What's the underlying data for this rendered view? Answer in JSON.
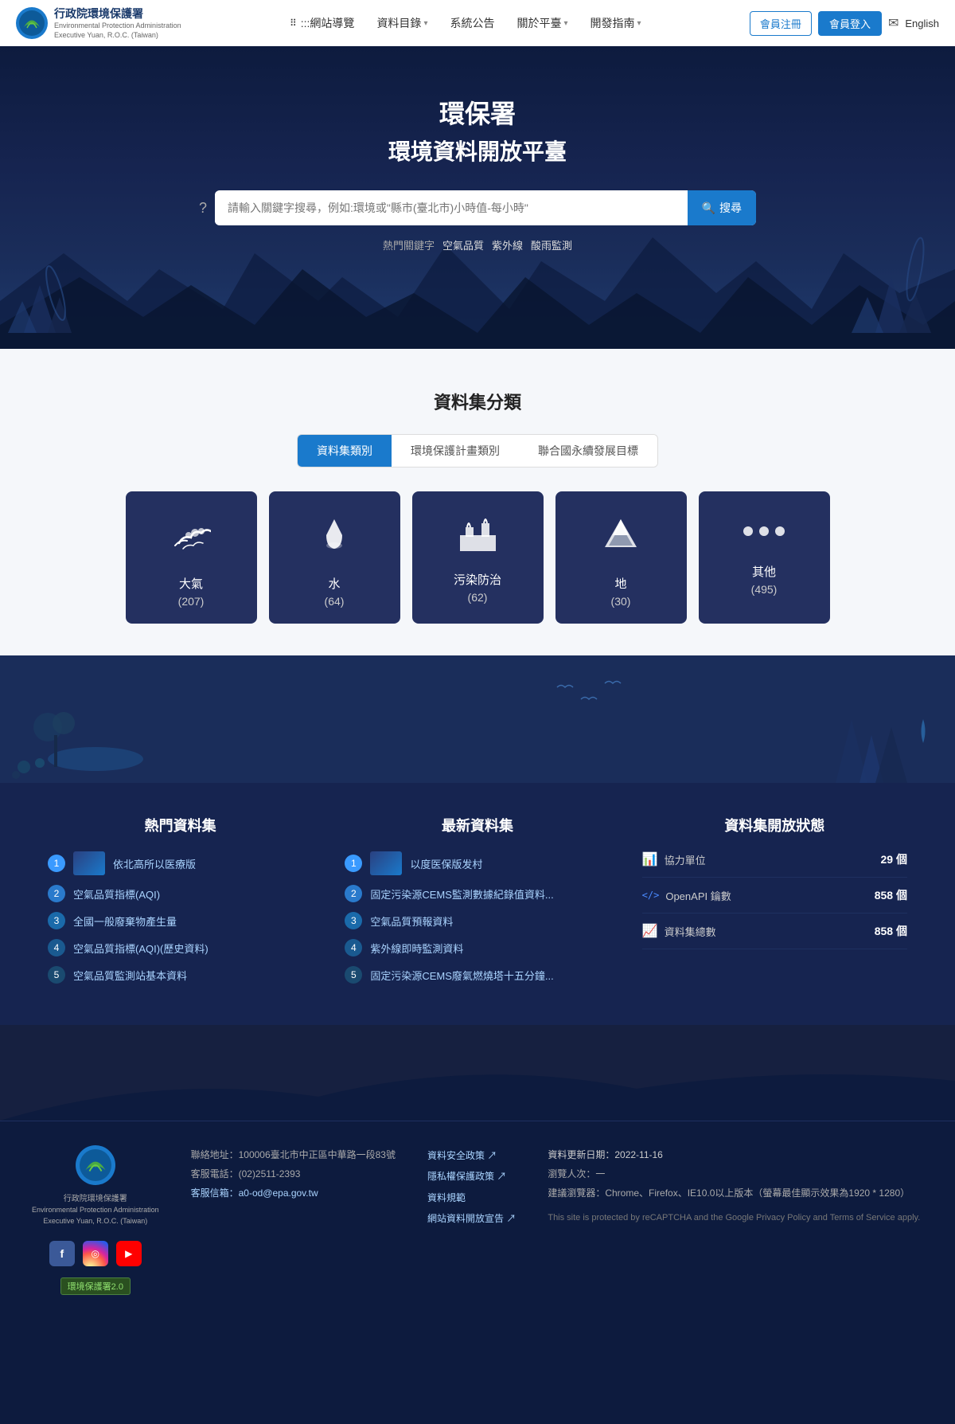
{
  "header": {
    "logo_main": "行政院環境保護署",
    "logo_sub": "Environmental Protection Administration\nExecutive Yuan, R.O.C. (Taiwan)",
    "nav": [
      {
        "label": ":::網站導覽",
        "id": "sitemap",
        "has_arrow": false
      },
      {
        "label": "資料目錄",
        "id": "catalog",
        "has_arrow": true
      },
      {
        "label": "系統公告",
        "id": "notice",
        "has_arrow": false
      },
      {
        "label": "關於平臺",
        "id": "about",
        "has_arrow": true
      },
      {
        "label": "開發指南",
        "id": "devguide",
        "has_arrow": true
      }
    ],
    "btn_register": "會員注冊",
    "btn_login": "會員登入",
    "lang": "English"
  },
  "hero": {
    "title_main": "環保署",
    "title_sub": "環境資料開放平臺",
    "search_placeholder": "請輸入關鍵字搜尋，例如:環境或\"縣市(臺北市)小時值-每小時\"",
    "search_btn": "搜尋",
    "hot_label": "熱門關鍵字",
    "hot_keywords": [
      "空氣品質",
      "紫外線",
      "酸雨監測"
    ]
  },
  "categories": {
    "title": "資料集分類",
    "tabs": [
      {
        "label": "資料集類別",
        "active": true
      },
      {
        "label": "環境保護計畫類別",
        "active": false
      },
      {
        "label": "聯合國永續發展目標",
        "active": false
      }
    ],
    "cards": [
      {
        "icon": "☁",
        "label": "大氣",
        "count": "(207)"
      },
      {
        "icon": "💧",
        "label": "水",
        "count": "(64)"
      },
      {
        "icon": "🏭",
        "label": "污染防治",
        "count": "(62)"
      },
      {
        "icon": "⛰",
        "label": "地",
        "count": "(30)"
      },
      {
        "icon": "•••",
        "label": "其他",
        "count": "(495)"
      }
    ]
  },
  "hot_datasets": {
    "title": "熱門資料集",
    "items": [
      {
        "num": 1,
        "label": "依北高所以医療版",
        "has_thumb": true
      },
      {
        "num": 2,
        "label": "空氣品質指標(AQI)"
      },
      {
        "num": 3,
        "label": "全國一般廢棄物產生量"
      },
      {
        "num": 4,
        "label": "空氣品質指標(AQI)(歷史資料)"
      },
      {
        "num": 5,
        "label": "空氣品質監測站基本資料"
      }
    ]
  },
  "new_datasets": {
    "title": "最新資料集",
    "items": [
      {
        "num": 1,
        "label": "以度医保版发村",
        "has_thumb": true
      },
      {
        "num": 2,
        "label": "固定污染源CEMS監測數據紀錄值資料..."
      },
      {
        "num": 3,
        "label": "空氣品質預報資料"
      },
      {
        "num": 4,
        "label": "紫外線即時監測資料"
      },
      {
        "num": 5,
        "label": "固定污染源CEMS廢氣燃燒塔十五分鐘..."
      }
    ]
  },
  "open_status": {
    "title": "資料集開放狀態",
    "rows": [
      {
        "icon": "📊",
        "label": "協力單位",
        "value": "29 個"
      },
      {
        "icon": "</>",
        "label": "OpenAPI 鑰數",
        "value": "858 個"
      },
      {
        "icon": "📈",
        "label": "資料集總數",
        "value": "858 個"
      }
    ]
  },
  "footer": {
    "logo_main": "行政院環境保護署",
    "logo_sub": "Environmental Protection Administration\nExecutive Yuan, R.O.C. (Taiwan)",
    "contact": {
      "address": "聯絡地址：100006臺北市中正區中華路一段83號",
      "phone": "客服電話：(02)2511-2393",
      "email": "客服信箱：a0-od@epa.gov.tw"
    },
    "links": [
      {
        "label": "資料安全政策 ↗",
        "url": "#"
      },
      {
        "label": "隱私權保護政策 ↗",
        "url": "#"
      },
      {
        "label": "資料規範",
        "url": "#"
      },
      {
        "label": "網站資料開放宣告 ↗",
        "url": "#"
      }
    ],
    "update_date": "資料更新日期：2022-11-16",
    "visitors": "瀏覽人次：一",
    "browser": "建議瀏覽器：Chrome、Firefox、IE10.0以上版本（螢幕最佳顯示效果為1920 * 1280）",
    "recaptcha": "This site is protected by reCAPTCHA and the Google Privacy Policy and Terms of Service apply.",
    "cert_label": "環境保護署2.0",
    "social": [
      {
        "icon": "f",
        "platform": "facebook"
      },
      {
        "icon": "◎",
        "platform": "instagram"
      },
      {
        "icon": "▶",
        "platform": "youtube"
      }
    ]
  }
}
